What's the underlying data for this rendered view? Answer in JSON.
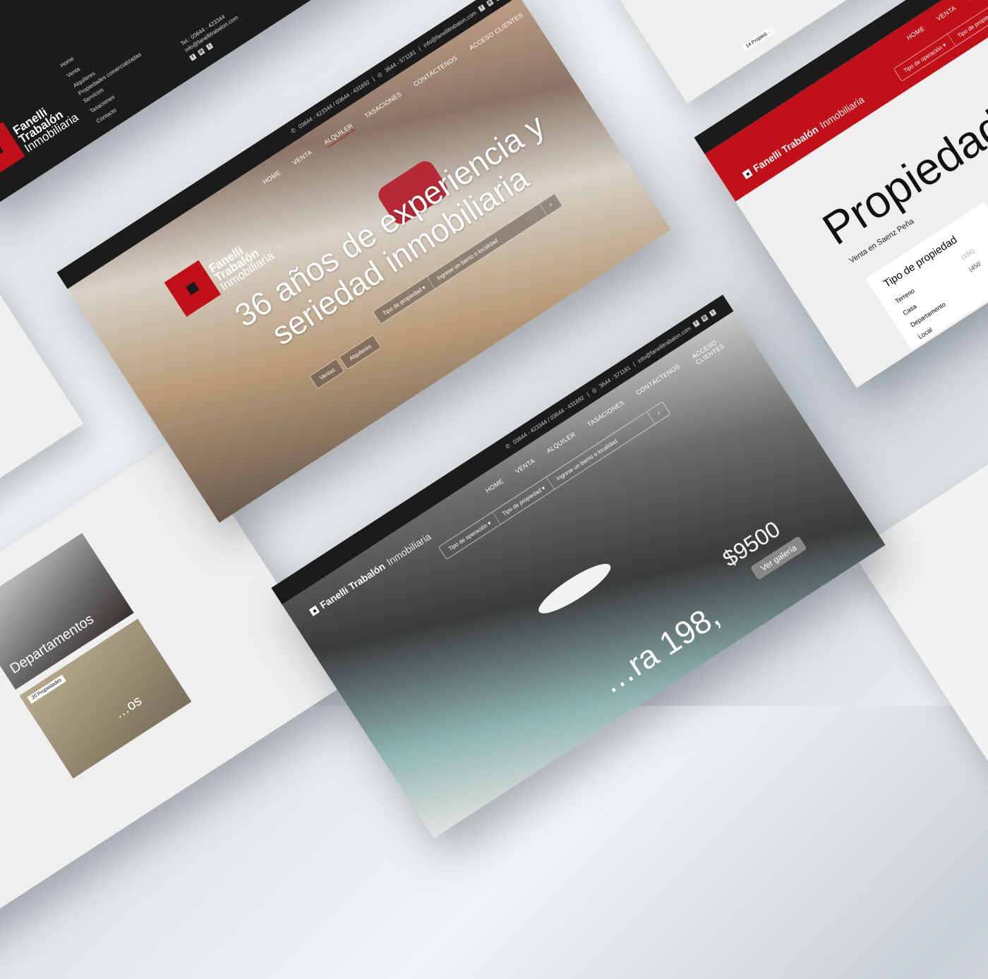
{
  "brand": {
    "line1": "Fanelli",
    "line2": "Trabalón",
    "line3": "Inmobiliaria",
    "inline_name": "Fanelli Trabalón",
    "inline_suffix": "Inmobiliaria",
    "red": "#c0101a",
    "dark": "#1b1b1b"
  },
  "contact_bar": {
    "phones": "03644 - 423344 / 03644 - 431692",
    "whatsapp": "3644 - 571181",
    "email": "info@fanellitrabalon.com",
    "separator": "|",
    "social": [
      "f",
      "◎",
      "t"
    ]
  },
  "nav": [
    "HOME",
    "VENTA",
    "ALQUILER",
    "TASACIONES",
    "CONTÁCTENOS",
    "ACCESO CLIENTES"
  ],
  "hero": {
    "title_line1": "36 años de experiencia y",
    "title_line2": "seriedad inmobiliaria",
    "tab_sale": "Ventas",
    "tab_rent": "Alquileres",
    "property_type": "Tipo de propiedad ▾",
    "search_placeholder": "Ingrese un barrio o localidad"
  },
  "footer": {
    "menu": [
      "Home",
      "Venta",
      "Alquileres",
      "Propiedades comercializadas",
      "Servicios",
      "Tasaciones",
      "Contacto"
    ],
    "tel": "Tel.: 03644 - 423344",
    "email": "info@fanellitrabalon.com"
  },
  "listing": {
    "operation": "Tipo de operación ▾",
    "property_type": "Tipo de propiedad ▾",
    "search_placeholder": "Ingrese un barrio o localidad",
    "price": "$9500",
    "gallery_button": "Ver galería",
    "address": "…ra 198,"
  },
  "results": {
    "title": "Propiedades",
    "subtitle": "Venta en Saenz Peña",
    "filter_title": "Tipo de propiedad",
    "filter_items": [
      "Terreno",
      "Casa",
      "Departamento",
      "Local"
    ],
    "counts": [
      "(156)",
      "(450"
    ]
  },
  "categories": {
    "card1": "Departamentos",
    "badge": "20 Propiedades",
    "card2_partial": "…os"
  },
  "side_badge": "14 Propied…"
}
